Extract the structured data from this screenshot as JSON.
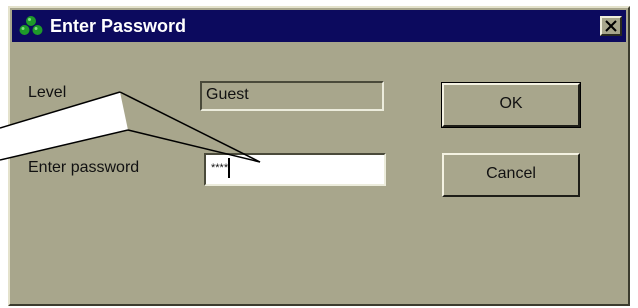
{
  "window": {
    "title": "Enter Password",
    "icon": "app-clover-icon",
    "close_icon": "close-icon"
  },
  "form": {
    "level_label": "Level",
    "level_value": "Guest",
    "password_label": "Enter password",
    "password_value": "****"
  },
  "buttons": {
    "ok_label": "OK",
    "cancel_label": "Cancel"
  },
  "colors": {
    "titlebar": "#0c0a5e",
    "dialog_background": "#a8a68c"
  }
}
